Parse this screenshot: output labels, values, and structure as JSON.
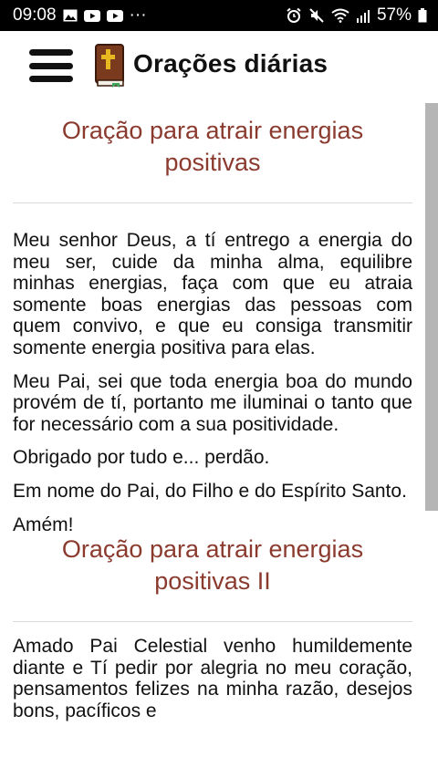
{
  "status_bar": {
    "time": "09:08",
    "more": "···",
    "battery": "57%"
  },
  "header": {
    "title": "Orações diárias"
  },
  "prayers": [
    {
      "title": "Oração para atrair energias positivas",
      "paragraphs": [
        "Meu senhor Deus, a tí entrego a energia do meu ser, cuide da minha alma, equilibre minhas energias, faça com que eu atraia somente boas energias das pessoas com quem convivo, e que eu consiga transmitir somente energia positiva para elas.",
        "Meu Pai, sei que toda energia boa do mundo provém de tí, portanto me iluminai o tanto que for necessário com a sua positividade.",
        "Obrigado por tudo e... perdão.",
        "Em nome do Pai, do Filho e do Espírito Santo.",
        "Amém!"
      ]
    },
    {
      "title": "Oração para atrair energias positivas II",
      "paragraphs": [
        "Amado Pai Celestial venho humildemente diante e Tí pedir por alegria no meu coração, pensamentos felizes na minha razão, desejos bons, pacíficos e"
      ]
    }
  ],
  "colors": {
    "title": "#8b3a2e",
    "status_bar": "#000000",
    "scrollbar": "#b5b5b5"
  }
}
